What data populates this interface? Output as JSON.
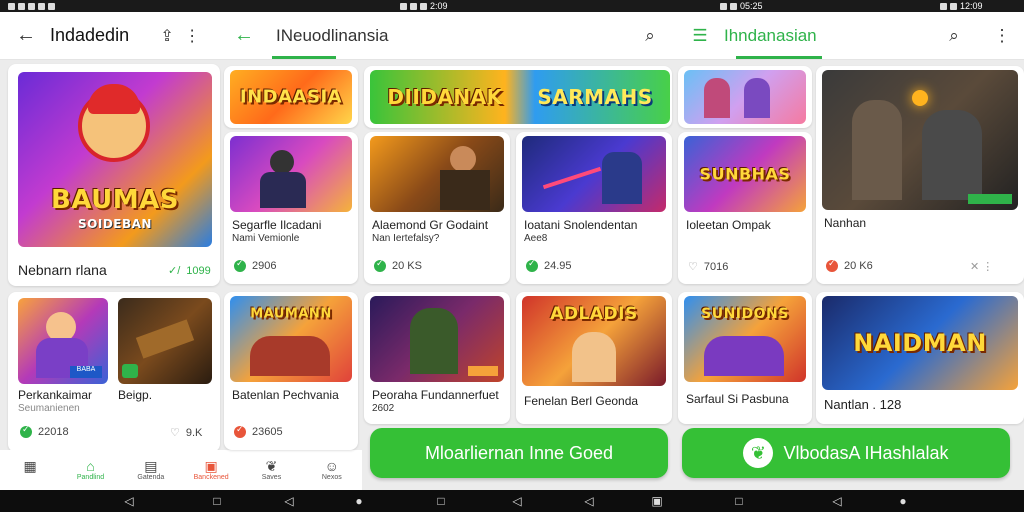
{
  "status": {
    "time1": "2:09",
    "time2": "05:25",
    "time3": "12:09"
  },
  "headers": [
    {
      "title": "Indadedin",
      "left_icon": "back-arrow-icon",
      "right_icons": [
        "share-icon",
        "more-icon"
      ]
    },
    {
      "title": "INeuodlinansia",
      "left_icon": "back-arrow-icon",
      "right_icons": [
        "search-icon"
      ]
    },
    {
      "title": "Ihndanasian",
      "left_icon": "menu-icon",
      "right_icons": [
        "search-icon",
        "more-icon"
      ]
    }
  ],
  "featured": {
    "art_text": "BAUMAS\nSOIDEBAN",
    "title": "Nebnarn rlana",
    "rating": "1099"
  },
  "cards": [
    {
      "art": "INDAASIA",
      "title": "",
      "sub": "",
      "rating": ""
    },
    {
      "art": "DIIDANAK  SARMAHS",
      "title": "",
      "sub": "",
      "rating": ""
    },
    {
      "art": "",
      "title": "",
      "sub": "",
      "rating": ""
    },
    {
      "art": "",
      "title": "Segarfle Ilcadani",
      "sub": "Nami Vemionle",
      "rating": "2906"
    },
    {
      "art": "",
      "title": "Alaemond Gr Godaint",
      "sub": "Nan Iertefalsy?",
      "rating": "20 KS"
    },
    {
      "art": "",
      "title": "Ioatani Snolendentan",
      "sub": "Aee8",
      "rating": "24.95"
    },
    {
      "art": "SUNBHAS",
      "title": "Ioleetan Ompak",
      "sub": "",
      "rating": "7016"
    },
    {
      "art": "",
      "title": "Nanhan",
      "sub": "",
      "rating": "20 K6"
    },
    {
      "art": "",
      "title": "Perkankaimar",
      "sub": "Seumanienen",
      "rating": "22018"
    },
    {
      "art": "",
      "title": "Beigp.",
      "sub": "",
      "rating": "9.K"
    },
    {
      "art": "MAUMANN",
      "title": "Batenlan Pechvania",
      "sub": "",
      "rating": "23605"
    },
    {
      "art": "",
      "title": "Peoraha Fundannerfuet",
      "sub": "2602",
      "rating": ""
    },
    {
      "art": "ADLADIS",
      "title": "Fenelan Berl Geonda",
      "sub": "",
      "rating": ""
    },
    {
      "art": "SUNIDONS",
      "title": "Sarfaul Si Pasbuna",
      "sub": "",
      "rating": ""
    },
    {
      "art": "NAIDMAN",
      "title": "Nantlan . 128",
      "sub": "",
      "rating": ""
    }
  ],
  "tabs": [
    {
      "label": "",
      "icon": "grid-icon"
    },
    {
      "label": "Pandlind",
      "icon": "home-icon"
    },
    {
      "label": "Gatenda",
      "icon": "list-icon"
    },
    {
      "label": "Banckened",
      "icon": "store-icon"
    },
    {
      "label": "Saves",
      "icon": "leaf-icon"
    },
    {
      "label": "Nexos",
      "icon": "user-icon"
    }
  ],
  "cta": [
    {
      "label": "Mloarliernan Inne Goed"
    },
    {
      "label": "VlbodasA IHashlalak"
    }
  ]
}
